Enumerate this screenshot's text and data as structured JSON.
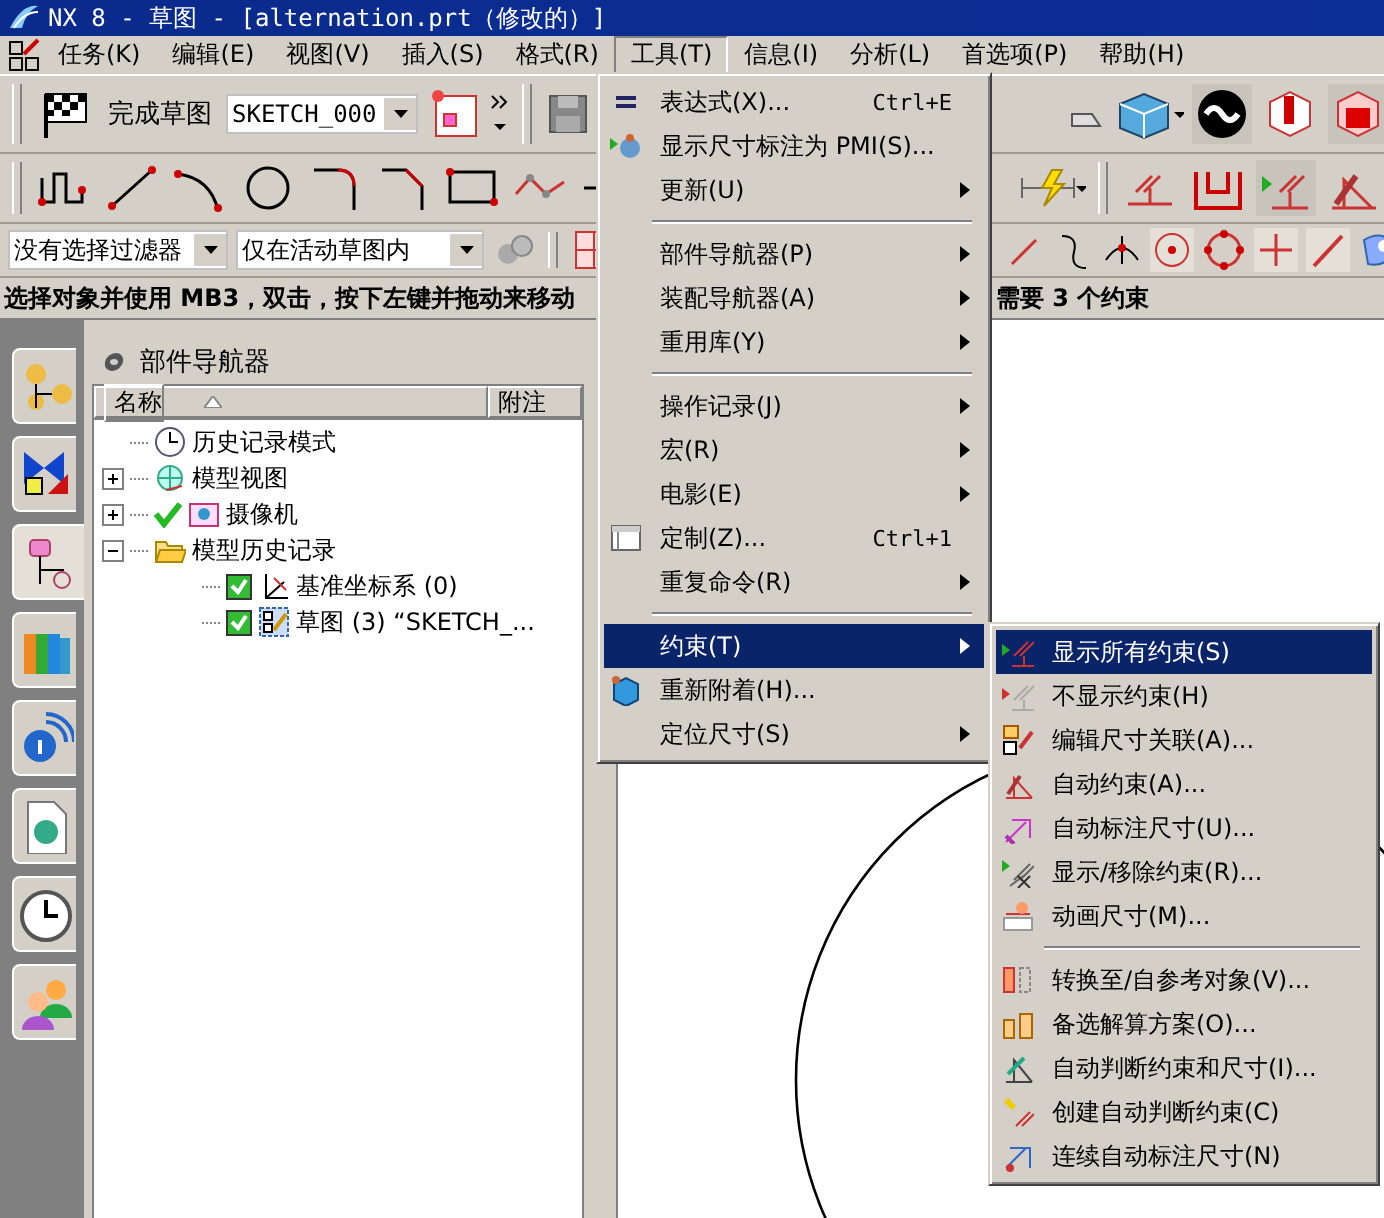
{
  "window": {
    "title": "NX 8 - 草图 - [alternation.prt（修改的）]"
  },
  "menu_bar": [
    {
      "label": "任务(K)",
      "selected": false
    },
    {
      "label": "编辑(E)",
      "selected": false
    },
    {
      "label": "视图(V)",
      "selected": false
    },
    {
      "label": "插入(S)",
      "selected": false
    },
    {
      "label": "格式(R)",
      "selected": false
    },
    {
      "label": "工具(T)",
      "selected": true
    },
    {
      "label": "信息(I)",
      "selected": false
    },
    {
      "label": "分析(L)",
      "selected": false
    },
    {
      "label": "首选项(P)",
      "selected": false
    },
    {
      "label": "帮助(H)",
      "selected": false
    }
  ],
  "toolbar": {
    "finish_sketch": "完成草图",
    "sketch_name": "SKETCH_000",
    "selection_filter": "没有选择过滤器",
    "scope": "仅在活动草图内"
  },
  "status_line": {
    "prompt": "选择对象并使用 MB3，双击，按下左键并拖动来移动",
    "constraint_status": "需要 3 个约束"
  },
  "side_tabs": [
    {
      "selected": false
    },
    {
      "selected": false
    },
    {
      "selected": true
    },
    {
      "selected": false
    },
    {
      "selected": false
    },
    {
      "selected": false
    },
    {
      "selected": false
    },
    {
      "selected": false
    }
  ],
  "navigator": {
    "title": "部件导航器",
    "columns": [
      "名称",
      "附注"
    ],
    "tree": [
      {
        "kind": "history",
        "label": "历史记录模式"
      },
      {
        "kind": "view",
        "label": "模型视图",
        "expanded": false
      },
      {
        "kind": "camera",
        "label": "摄像机",
        "expanded": false,
        "checked": true
      },
      {
        "kind": "folder",
        "label": "模型历史记录",
        "expanded": true,
        "children": [
          {
            "kind": "datum",
            "label": "基准坐标系 (0)",
            "checked": true
          },
          {
            "kind": "sketch",
            "label": "草图 (3) “SKETCH_...",
            "checked": true
          }
        ]
      }
    ]
  },
  "tools_menu": [
    {
      "kind": "item",
      "label": "表达式(X)...",
      "shortcut": "Ctrl+E",
      "submenu": false,
      "selected": false
    },
    {
      "kind": "item",
      "label": "显示尺寸标注为 PMI(S)...",
      "submenu": false,
      "selected": false
    },
    {
      "kind": "item",
      "label": "更新(U)",
      "submenu": true,
      "selected": false
    },
    {
      "kind": "separator"
    },
    {
      "kind": "item",
      "label": "部件导航器(P)",
      "submenu": true,
      "selected": false
    },
    {
      "kind": "item",
      "label": "装配导航器(A)",
      "submenu": true,
      "selected": false
    },
    {
      "kind": "item",
      "label": "重用库(Y)",
      "submenu": true,
      "selected": false
    },
    {
      "kind": "separator"
    },
    {
      "kind": "item",
      "label": "操作记录(J)",
      "submenu": true,
      "selected": false
    },
    {
      "kind": "item",
      "label": "宏(R)",
      "submenu": true,
      "selected": false
    },
    {
      "kind": "item",
      "label": "电影(E)",
      "submenu": true,
      "selected": false
    },
    {
      "kind": "item",
      "label": "定制(Z)...",
      "shortcut": "Ctrl+1",
      "submenu": false,
      "selected": false
    },
    {
      "kind": "item",
      "label": "重复命令(R)",
      "submenu": true,
      "selected": false
    },
    {
      "kind": "separator"
    },
    {
      "kind": "item",
      "label": "约束(T)",
      "submenu": true,
      "selected": true
    },
    {
      "kind": "item",
      "label": "重新附着(H)...",
      "submenu": false,
      "selected": false
    },
    {
      "kind": "item",
      "label": "定位尺寸(S)",
      "submenu": true,
      "selected": false
    }
  ],
  "constraints_submenu": [
    {
      "kind": "item",
      "label": "显示所有约束(S)",
      "selected": true
    },
    {
      "kind": "item",
      "label": "不显示约束(H)",
      "selected": false
    },
    {
      "kind": "item",
      "label": "编辑尺寸关联(A)...",
      "selected": false
    },
    {
      "kind": "item",
      "label": "自动约束(A)...",
      "selected": false
    },
    {
      "kind": "item",
      "label": "自动标注尺寸(U)...",
      "selected": false
    },
    {
      "kind": "item",
      "label": "显示/移除约束(R)...",
      "selected": false
    },
    {
      "kind": "item",
      "label": "动画尺寸(M)...",
      "selected": false
    },
    {
      "kind": "separator"
    },
    {
      "kind": "item",
      "label": "转换至/自参考对象(V)...",
      "selected": false
    },
    {
      "kind": "item",
      "label": "备选解算方案(O)...",
      "selected": false
    },
    {
      "kind": "item",
      "label": "自动判断约束和尺寸(I)...",
      "selected": false
    },
    {
      "kind": "item",
      "label": "创建自动判断约束(C)",
      "selected": false
    },
    {
      "kind": "item",
      "label": "连续自动标注尺寸(N)",
      "selected": false
    }
  ]
}
